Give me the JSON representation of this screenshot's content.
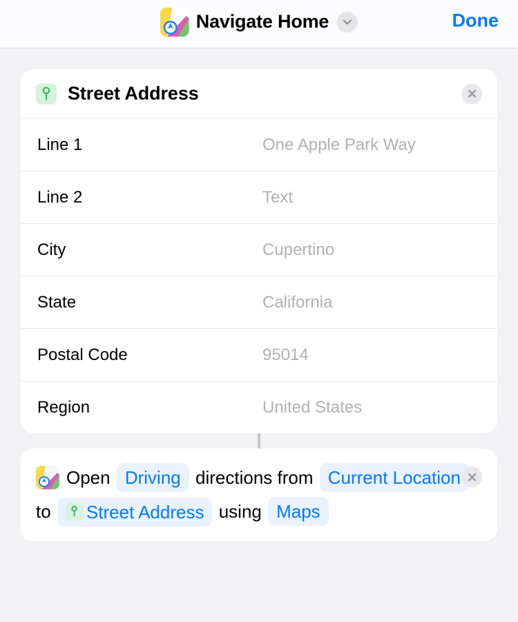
{
  "header": {
    "title": "Navigate Home",
    "done_label": "Done"
  },
  "address_card": {
    "title": "Street Address",
    "fields": [
      {
        "label": "Line 1",
        "placeholder": "One Apple Park Way"
      },
      {
        "label": "Line 2",
        "placeholder": "Text"
      },
      {
        "label": "City",
        "placeholder": "Cupertino"
      },
      {
        "label": "State",
        "placeholder": "California"
      },
      {
        "label": "Postal Code",
        "placeholder": "95014"
      },
      {
        "label": "Region",
        "placeholder": "United States"
      }
    ]
  },
  "action_card": {
    "prefix": "Open",
    "mode_token": "Driving",
    "mid1": "directions from",
    "from_token": "Current Location",
    "mid2": "to",
    "to_token": "Street Address",
    "mid3": "using",
    "app_token": "Maps"
  }
}
